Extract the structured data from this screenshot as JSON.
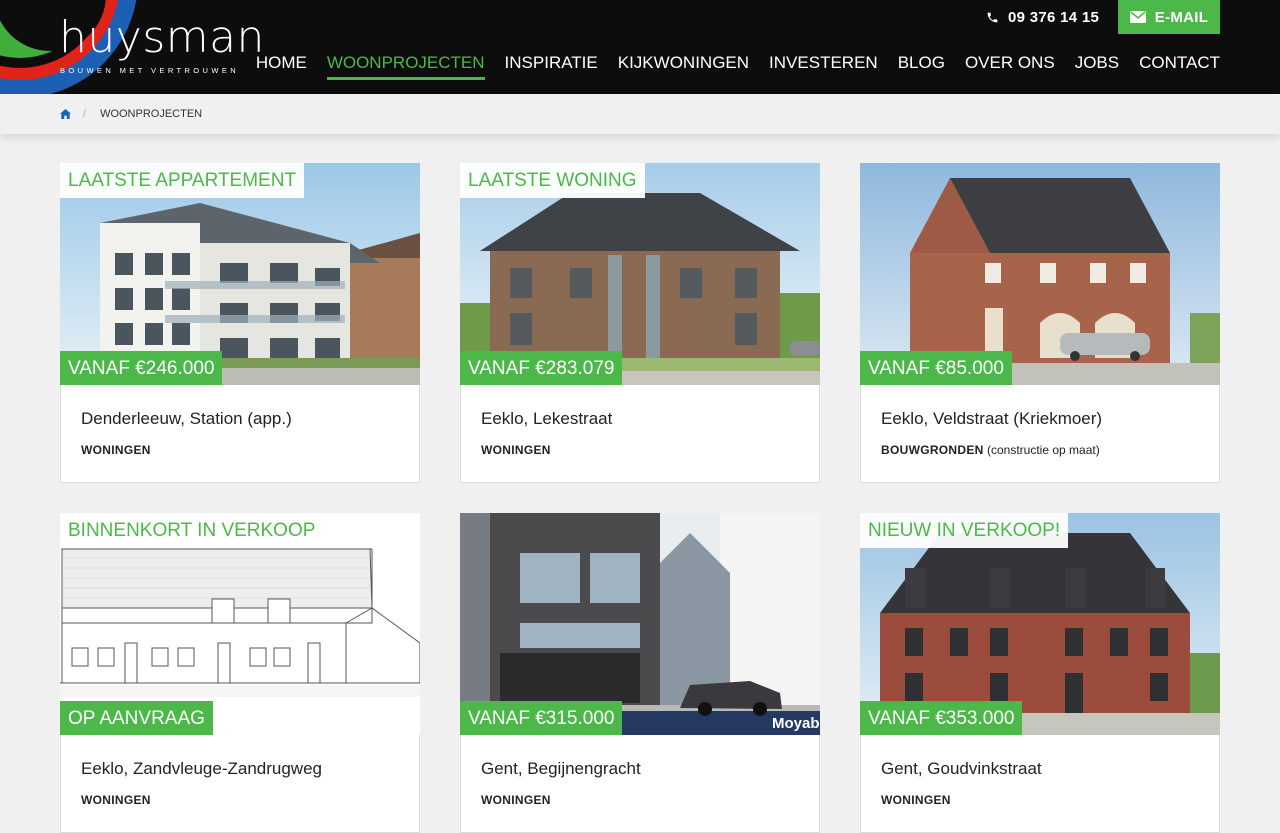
{
  "brand": {
    "name": "huysman",
    "tagline": "BOUWEN MET VERTROUWEN",
    "accent": "#4db84a"
  },
  "contact": {
    "phone": "09 376 14 15",
    "email_label": "E-MAIL"
  },
  "nav": [
    {
      "label": "HOME",
      "active": false
    },
    {
      "label": "WOONPROJECTEN",
      "active": true
    },
    {
      "label": "INSPIRATIE",
      "active": false
    },
    {
      "label": "KIJKWONINGEN",
      "active": false
    },
    {
      "label": "INVESTEREN",
      "active": false
    },
    {
      "label": "BLOG",
      "active": false
    },
    {
      "label": "OVER ONS",
      "active": false
    },
    {
      "label": "JOBS",
      "active": false
    },
    {
      "label": "CONTACT",
      "active": false
    }
  ],
  "breadcrumb": {
    "home_icon": "home-icon",
    "current": "WOONPROJECTEN"
  },
  "projects": [
    {
      "badge": "LAATSTE APPARTEMENT",
      "price": "VANAF €246.000",
      "title": "Denderleeuw, Station (app.)",
      "category": "WONINGEN",
      "note": ""
    },
    {
      "badge": "LAATSTE WONING",
      "price": "VANAF €283.079",
      "title": "Eeklo, Lekestraat",
      "category": "WONINGEN",
      "note": ""
    },
    {
      "badge": "",
      "price": "VANAF €85.000",
      "title": "Eeklo, Veldstraat (Kriekmoer)",
      "category": "BOUWGRONDEN",
      "note": "(constructie op maat)"
    },
    {
      "badge": "BINNENKORT IN VERKOOP",
      "price": "OP AANVRAAG",
      "title": "Eeklo, Zandvleuge-Zandrugweg",
      "category": "WONINGEN",
      "note": ""
    },
    {
      "badge": "",
      "price": "VANAF €315.000",
      "title": "Gent, Begijnengracht",
      "category": "WONINGEN",
      "note": "",
      "image_watermark": "Moyabe"
    },
    {
      "badge": "NIEUW IN VERKOOP!",
      "price": "VANAF €353.000",
      "title": "Gent, Goudvinkstraat",
      "category": "WONINGEN",
      "note": ""
    }
  ]
}
